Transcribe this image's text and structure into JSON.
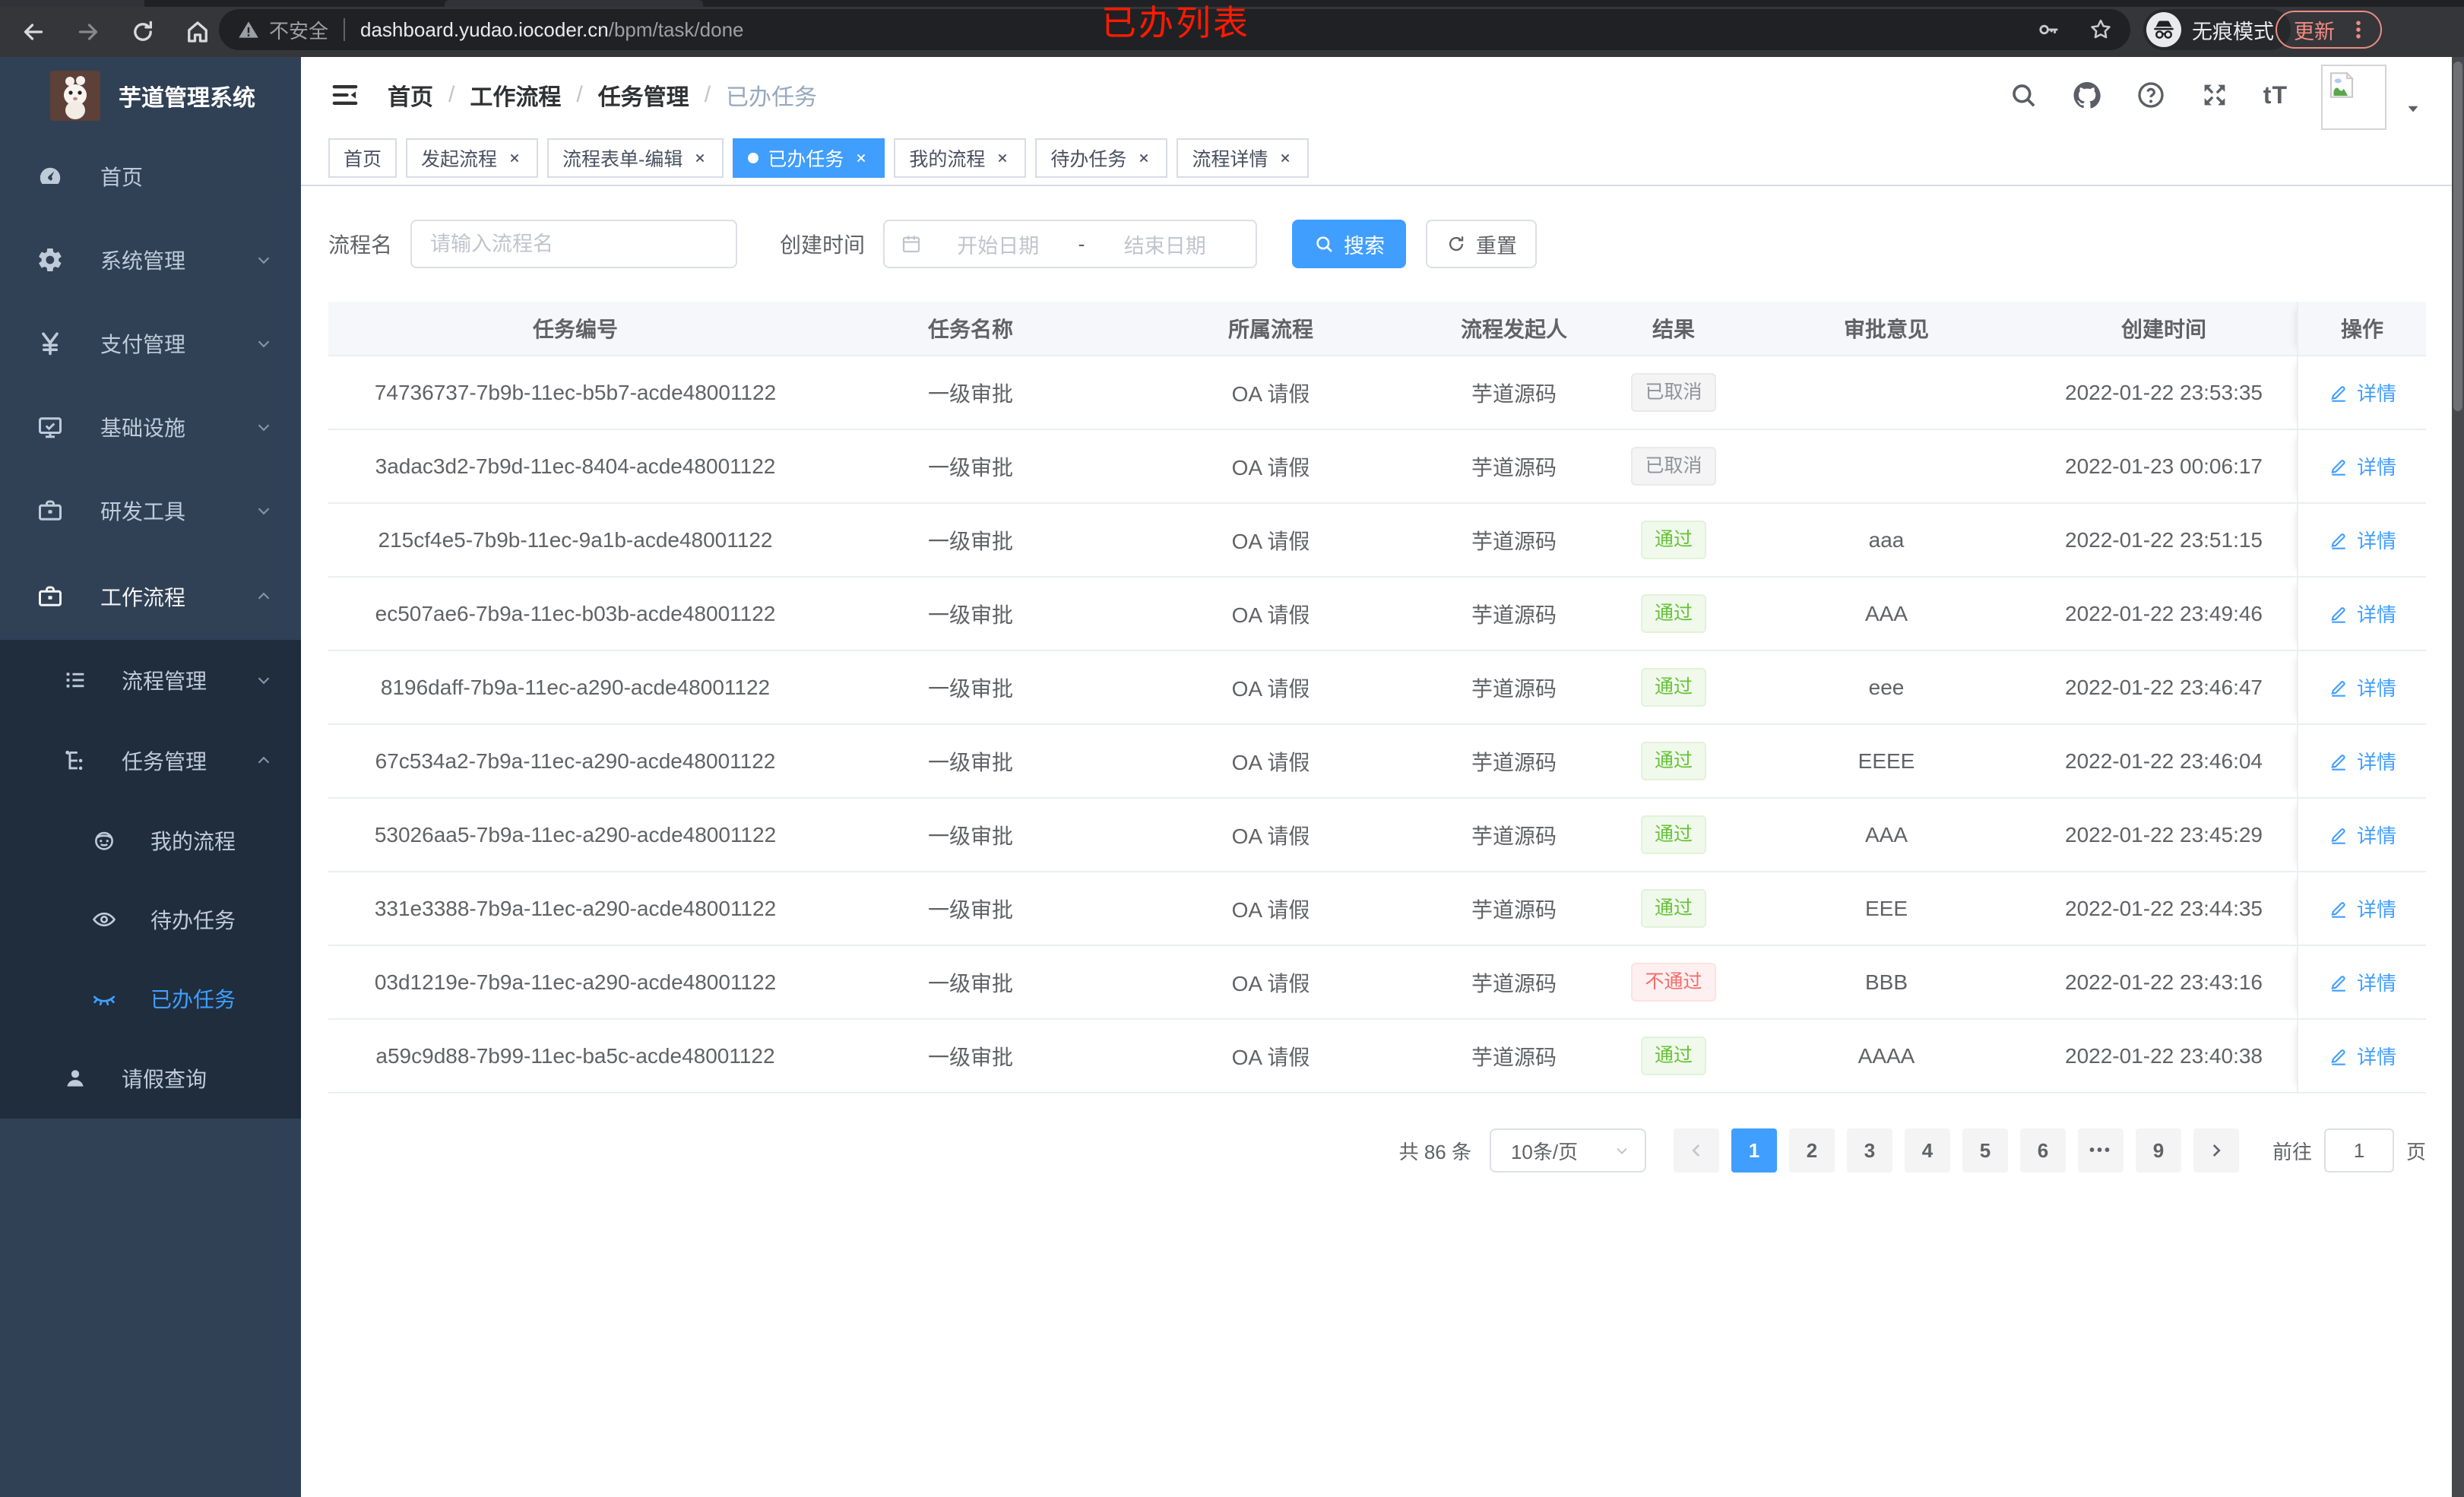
{
  "browser": {
    "security_label": "不安全",
    "url_host": "dashboard.yudao.iocoder.cn",
    "url_path": "/bpm/task/done",
    "incognito_label": "无痕模式",
    "update_label": "更新",
    "annotation": "已办列表"
  },
  "icons": {
    "security": "warning-triangle",
    "credentials": "key",
    "bookmark": "star",
    "incognito": "hat-and-glasses",
    "menu": "three-dots-vertical",
    "sidebar_home": "dashboard-gauge",
    "sidebar_system": "gear",
    "sidebar_pay": "yen",
    "sidebar_infra": "monitor",
    "sidebar_dev": "toolbox",
    "sidebar_workflow": "toolbox",
    "sidebar_process": "list",
    "sidebar_task": "tree",
    "sidebar_my": "face",
    "sidebar_todo": "eye-open",
    "sidebar_done": "eye-closed",
    "sidebar_leave": "person",
    "header": [
      "search",
      "github",
      "help-circle",
      "fullscreen",
      "font-size"
    ],
    "table_action": "edit-pencil",
    "filter_date": "calendar",
    "filter_search": "magnifier",
    "filter_reset": "refresh"
  },
  "sidebar": {
    "title": "芋道管理系统",
    "items": {
      "home": "首页",
      "system": "系统管理",
      "pay": "支付管理",
      "infra": "基础设施",
      "dev": "研发工具",
      "workflow": "工作流程",
      "process_mgmt": "流程管理",
      "task_mgmt": "任务管理",
      "my_process": "我的流程",
      "todo": "待办任务",
      "done": "已办任务",
      "leave": "请假查询"
    }
  },
  "header": {
    "breadcrumb": [
      "首页",
      "工作流程",
      "任务管理",
      "已办任务"
    ],
    "breadcrumb_separator": "/"
  },
  "tabs": [
    {
      "label": "首页"
    },
    {
      "label": "发起流程"
    },
    {
      "label": "流程表单-编辑"
    },
    {
      "label": "已办任务"
    },
    {
      "label": "我的流程"
    },
    {
      "label": "待办任务"
    },
    {
      "label": "流程详情"
    }
  ],
  "filters": {
    "name_label": "流程名",
    "name_placeholder": "请输入流程名",
    "time_label": "创建时间",
    "start_placeholder": "开始日期",
    "range_separator": "-",
    "end_placeholder": "结束日期",
    "search_label": "搜索",
    "reset_label": "重置"
  },
  "table": {
    "columns": [
      "任务编号",
      "任务名称",
      "所属流程",
      "流程发起人",
      "结果",
      "审批意见",
      "创建时间",
      "操作"
    ],
    "action_label": "详情",
    "rows": [
      {
        "id": "74736737-7b9b-11ec-b5b7-acde48001122",
        "name": "一级审批",
        "flow": "OA 请假",
        "starter": "芋道源码",
        "result": "已取消",
        "result_type": "info",
        "opinion": "",
        "time": "2022-01-22 23:53:35"
      },
      {
        "id": "3adac3d2-7b9d-11ec-8404-acde48001122",
        "name": "一级审批",
        "flow": "OA 请假",
        "starter": "芋道源码",
        "result": "已取消",
        "result_type": "info",
        "opinion": "",
        "time": "2022-01-23 00:06:17"
      },
      {
        "id": "215cf4e5-7b9b-11ec-9a1b-acde48001122",
        "name": "一级审批",
        "flow": "OA 请假",
        "starter": "芋道源码",
        "result": "通过",
        "result_type": "success",
        "opinion": "aaa",
        "time": "2022-01-22 23:51:15"
      },
      {
        "id": "ec507ae6-7b9a-11ec-b03b-acde48001122",
        "name": "一级审批",
        "flow": "OA 请假",
        "starter": "芋道源码",
        "result": "通过",
        "result_type": "success",
        "opinion": "AAA",
        "time": "2022-01-22 23:49:46"
      },
      {
        "id": "8196daff-7b9a-11ec-a290-acde48001122",
        "name": "一级审批",
        "flow": "OA 请假",
        "starter": "芋道源码",
        "result": "通过",
        "result_type": "success",
        "opinion": "eee",
        "time": "2022-01-22 23:46:47"
      },
      {
        "id": "67c534a2-7b9a-11ec-a290-acde48001122",
        "name": "一级审批",
        "flow": "OA 请假",
        "starter": "芋道源码",
        "result": "通过",
        "result_type": "success",
        "opinion": "EEEE",
        "time": "2022-01-22 23:46:04"
      },
      {
        "id": "53026aa5-7b9a-11ec-a290-acde48001122",
        "name": "一级审批",
        "flow": "OA 请假",
        "starter": "芋道源码",
        "result": "通过",
        "result_type": "success",
        "opinion": "AAA",
        "time": "2022-01-22 23:45:29"
      },
      {
        "id": "331e3388-7b9a-11ec-a290-acde48001122",
        "name": "一级审批",
        "flow": "OA 请假",
        "starter": "芋道源码",
        "result": "通过",
        "result_type": "success",
        "opinion": "EEE",
        "time": "2022-01-22 23:44:35"
      },
      {
        "id": "03d1219e-7b9a-11ec-a290-acde48001122",
        "name": "一级审批",
        "flow": "OA 请假",
        "starter": "芋道源码",
        "result": "不通过",
        "result_type": "danger",
        "opinion": "BBB",
        "time": "2022-01-22 23:43:16"
      },
      {
        "id": "a59c9d88-7b99-11ec-ba5c-acde48001122",
        "name": "一级审批",
        "flow": "OA 请假",
        "starter": "芋道源码",
        "result": "通过",
        "result_type": "success",
        "opinion": "AAAA",
        "time": "2022-01-22 23:40:38"
      }
    ]
  },
  "pagination": {
    "total": "共 86 条",
    "page_size": "10条/页",
    "pages": [
      {
        "label": "1",
        "state": "active"
      },
      {
        "label": "2",
        "state": "normal"
      },
      {
        "label": "3",
        "state": "normal"
      },
      {
        "label": "4",
        "state": "normal"
      },
      {
        "label": "5",
        "state": "normal"
      },
      {
        "label": "6",
        "state": "normal"
      },
      {
        "label": "•••",
        "state": "more"
      },
      {
        "label": "9",
        "state": "normal"
      }
    ],
    "goto_label": "前往",
    "goto_value": "1",
    "unit_label": "页"
  },
  "colors": {
    "accent": "#409eff",
    "sidebar_bg": "#304156",
    "submenu_bg": "#1f2d3d",
    "success": "#67c23a",
    "danger": "#f56c6c",
    "info": "#909399",
    "annotation": "#ff1a00"
  }
}
